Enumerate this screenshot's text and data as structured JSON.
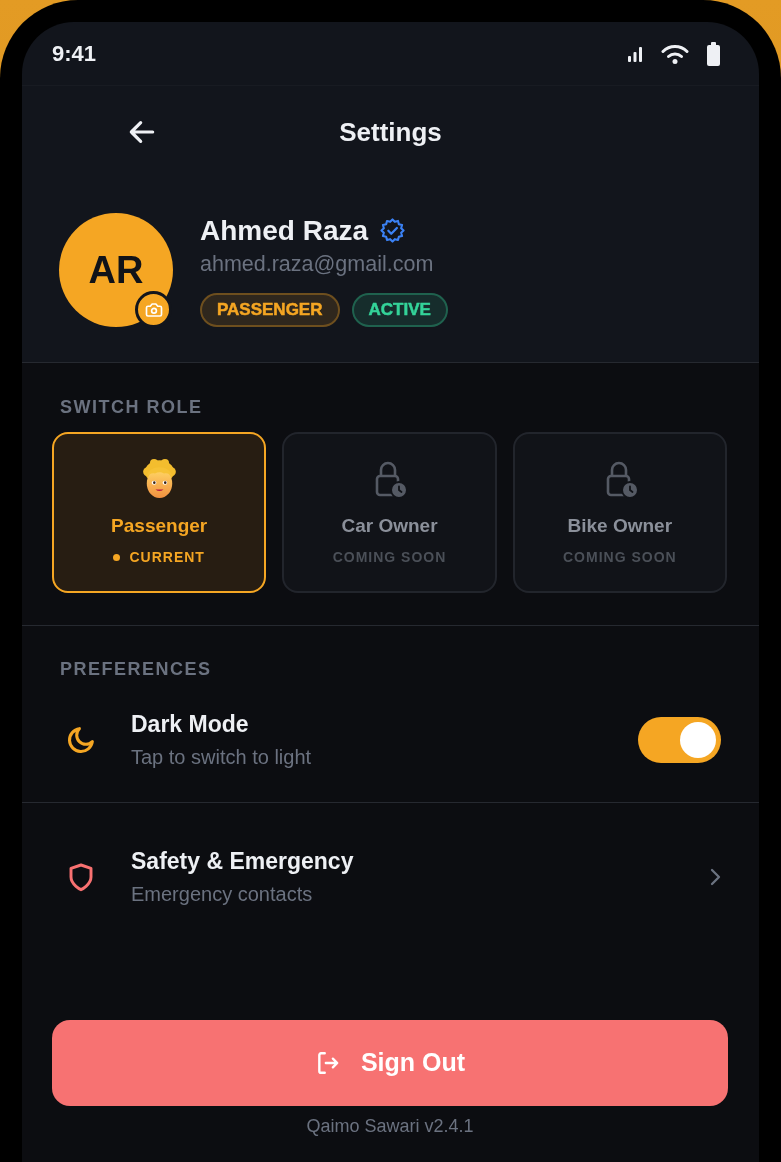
{
  "status_bar": {
    "time": "9:41"
  },
  "header": {
    "title": "Settings"
  },
  "profile": {
    "initials": "AR",
    "name": "Ahmed Raza",
    "verified": true,
    "email": "ahmed.raza@gmail.com",
    "tags": [
      {
        "label": "PASSENGER",
        "color": "#f5a623"
      },
      {
        "label": "ACTIVE",
        "color": "#34d399"
      }
    ]
  },
  "switch_role": {
    "heading": "SWITCH ROLE",
    "roles": [
      {
        "name": "Passenger",
        "status": "CURRENT",
        "selected": true,
        "locked": false
      },
      {
        "name": "Car Owner",
        "status": "COMING SOON",
        "selected": false,
        "locked": true
      },
      {
        "name": "Bike Owner",
        "status": "COMING SOON",
        "selected": false,
        "locked": true
      }
    ]
  },
  "preferences": {
    "heading": "PREFERENCES",
    "items": [
      {
        "kind": "toggle",
        "title": "Dark Mode",
        "subtitle": "Tap to switch to light",
        "on": true
      },
      {
        "kind": "link",
        "title": "Safety & Emergency",
        "subtitle": "Emergency contacts"
      }
    ]
  },
  "sign_out": {
    "label": "Sign Out"
  },
  "footer": {
    "version": "Qaimo Sawari v2.4.1"
  }
}
